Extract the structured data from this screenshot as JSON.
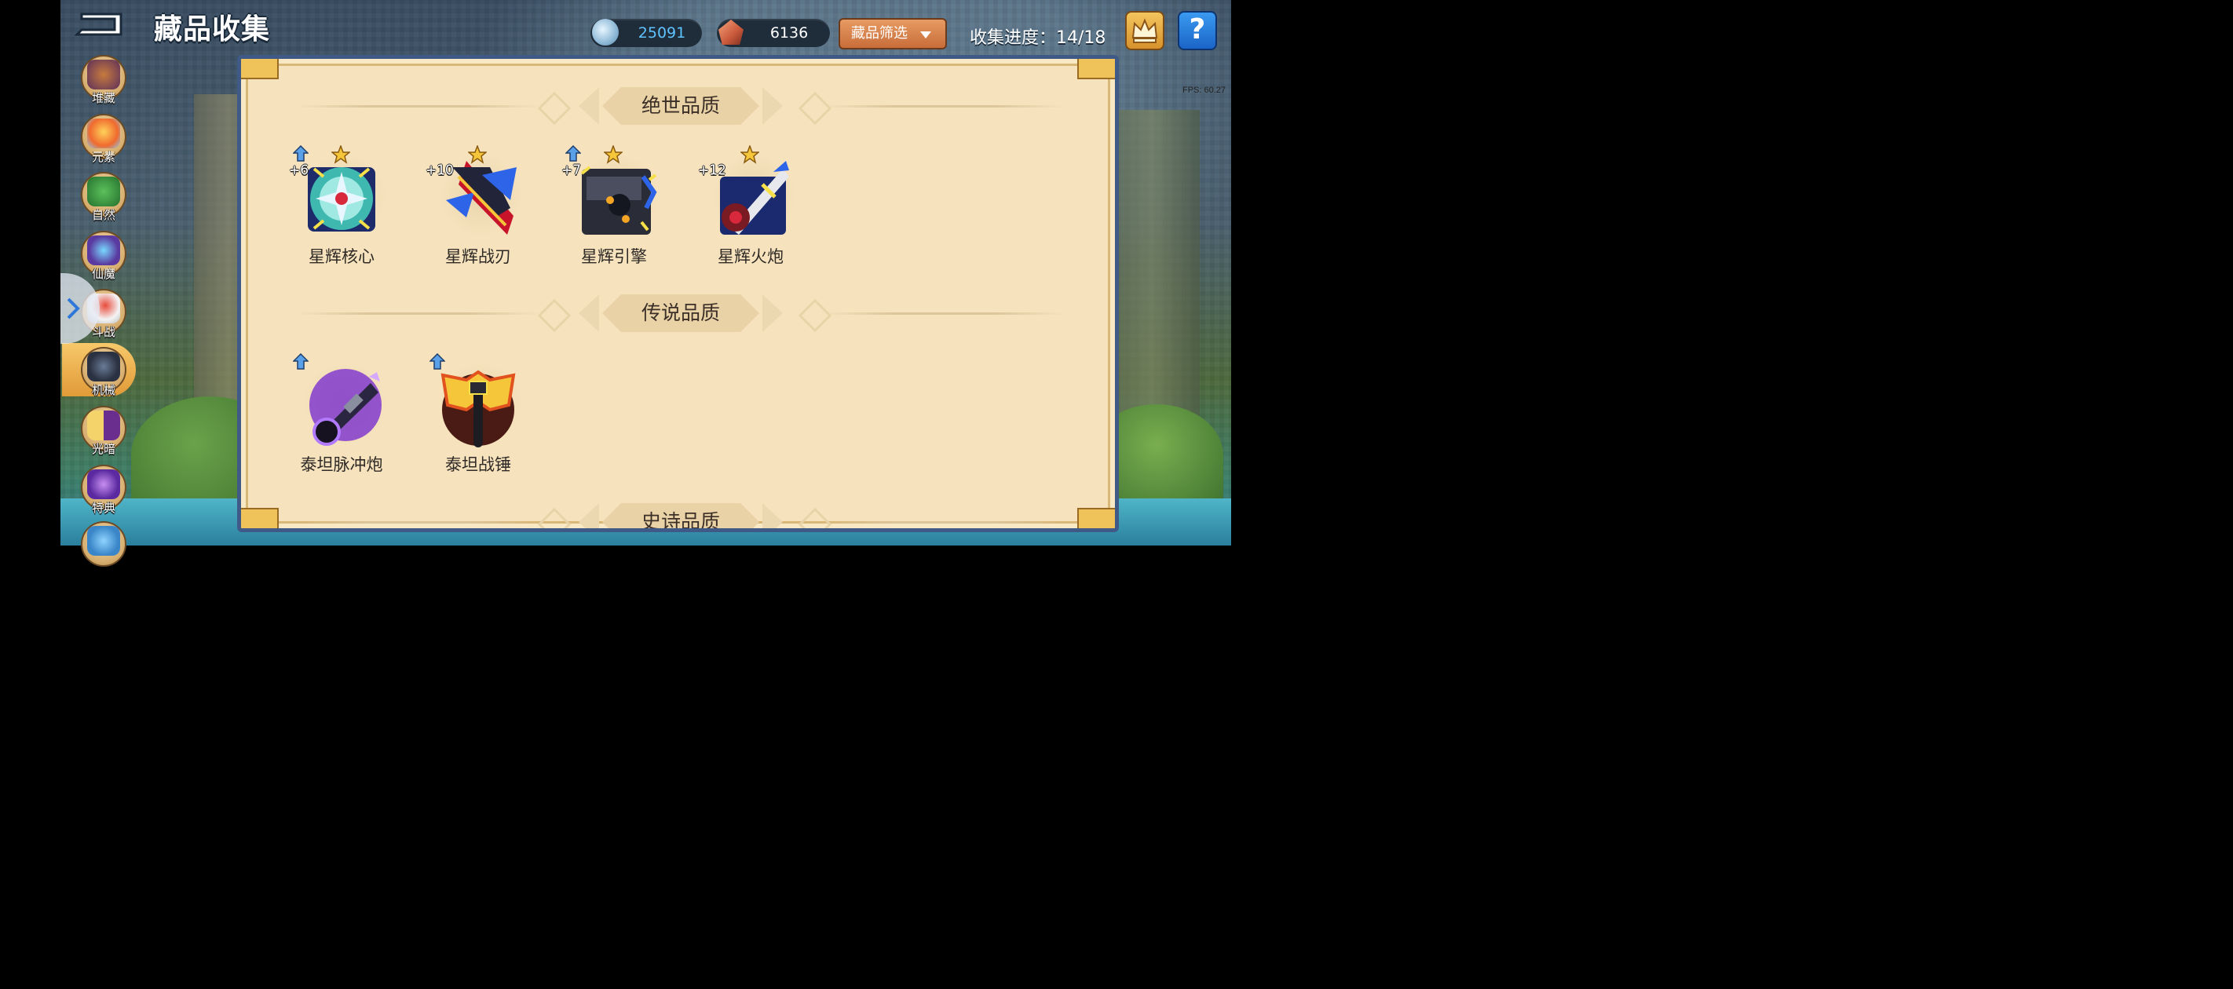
{
  "header": {
    "title": "藏品收集",
    "currency_gem": "25091",
    "currency_ore": "6136",
    "filter_label": "藏品筛选",
    "progress_label": "收集进度：14/18",
    "fps": "FPS: 60.27"
  },
  "sidebar": {
    "items": [
      {
        "label": "堆藏",
        "icon": "treasure-bag-icon"
      },
      {
        "label": "元素",
        "icon": "element-icon"
      },
      {
        "label": "自然",
        "icon": "nature-icon"
      },
      {
        "label": "仙魔",
        "icon": "fairy-demon-icon"
      },
      {
        "label": "斗战",
        "icon": "battle-icon"
      },
      {
        "label": "机械",
        "icon": "mech-icon",
        "active": true
      },
      {
        "label": "光暗",
        "icon": "light-dark-icon"
      },
      {
        "label": "特典",
        "icon": "special-icon"
      }
    ]
  },
  "sections": [
    {
      "title": "绝世品质",
      "items": [
        {
          "name": "星辉核心",
          "level": "+6",
          "starred": true,
          "upgradable": true,
          "icon": "star-core-icon"
        },
        {
          "name": "星辉战刃",
          "level": "+10",
          "starred": true,
          "upgradable": false,
          "icon": "star-blade-icon"
        },
        {
          "name": "星辉引擎",
          "level": "+7",
          "starred": true,
          "upgradable": true,
          "icon": "star-engine-icon"
        },
        {
          "name": "星辉火炮",
          "level": "+12",
          "starred": true,
          "upgradable": false,
          "icon": "star-cannon-icon"
        }
      ]
    },
    {
      "title": "传说品质",
      "items": [
        {
          "name": "泰坦脉冲炮",
          "level": "",
          "starred": false,
          "upgradable": true,
          "icon": "titan-pulse-cannon-icon"
        },
        {
          "name": "泰坦战锤",
          "level": "",
          "starred": false,
          "upgradable": true,
          "icon": "titan-hammer-icon"
        }
      ]
    },
    {
      "title": "史诗品质",
      "items": []
    }
  ],
  "colors": {
    "panel_bg": "#f6e3bd",
    "panel_border": "#3f5a86",
    "accent_orange": "#e79b62",
    "gem_value": "#5fc3ff",
    "text_dark": "#2f2a26"
  }
}
